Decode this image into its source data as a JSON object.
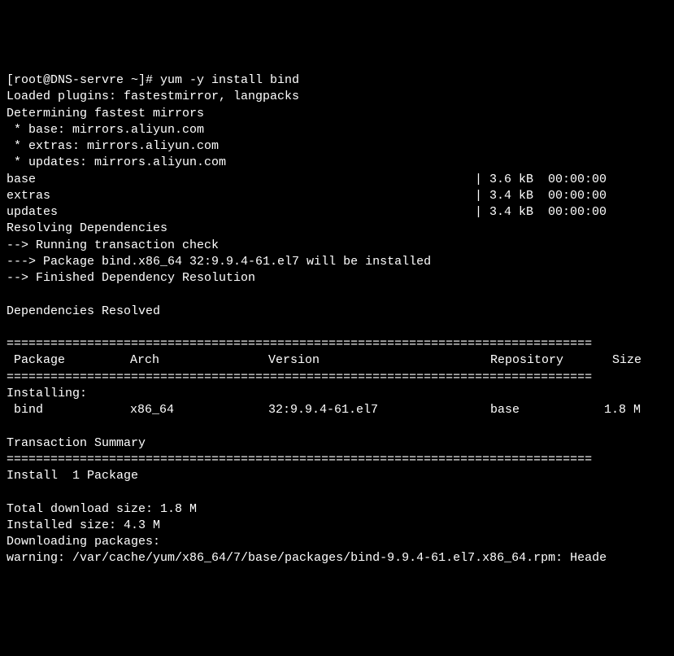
{
  "prompt": "[root@DNS-servre ~]# ",
  "command": "yum -y install bind",
  "line_loaded": "Loaded plugins: fastestmirror, langpacks",
  "line_determining": "Determining fastest mirrors",
  "mirror_base": " * base: mirrors.aliyun.com",
  "mirror_extras": " * extras: mirrors.aliyun.com",
  "mirror_updates": " * updates: mirrors.aliyun.com",
  "repos": [
    {
      "name": "base",
      "size": "3.6 kB",
      "time": "00:00:00"
    },
    {
      "name": "extras",
      "size": "3.4 kB",
      "time": "00:00:00"
    },
    {
      "name": "updates",
      "size": "3.4 kB",
      "time": "00:00:00"
    }
  ],
  "line_resolving": "Resolving Dependencies",
  "line_check": "--> Running transaction check",
  "line_pkg_install": "---> Package bind.x86_64 32:9.9.4-61.el7 will be installed",
  "line_finished": "--> Finished Dependency Resolution",
  "line_deps_resolved": "Dependencies Resolved",
  "hr": "================================================================================",
  "hdr_package": " Package",
  "hdr_arch": "Arch",
  "hdr_version": "Version",
  "hdr_repo": "Repository",
  "hdr_size": "Size",
  "line_installing": "Installing:",
  "row": {
    "package": " bind",
    "arch": "x86_64",
    "version": "32:9.9.4-61.el7",
    "repo": "base",
    "size": "1.8 M"
  },
  "line_tx_summary": "Transaction Summary",
  "line_install_count": "Install  1 Package",
  "line_total_dl": "Total download size: 1.8 M",
  "line_installed_size": "Installed size: 4.3 M",
  "line_downloading": "Downloading packages:",
  "line_warning": "warning: /var/cache/yum/x86_64/7/base/packages/bind-9.9.4-61.el7.x86_64.rpm: Heade"
}
